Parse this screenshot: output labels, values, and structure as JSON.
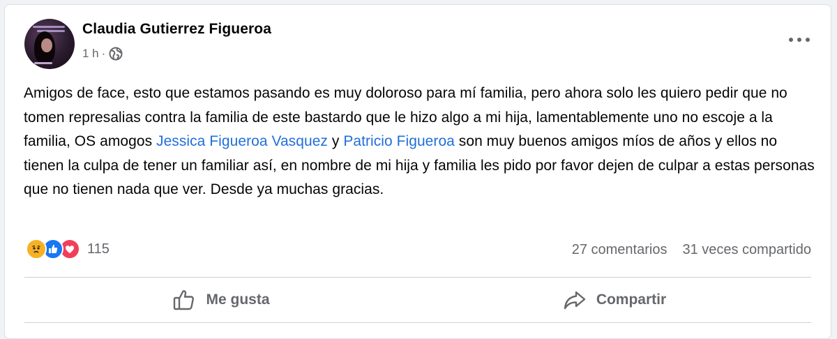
{
  "post": {
    "author": "Claudia Gutierrez Figueroa",
    "time": "1 h",
    "dot": "·",
    "text_parts": {
      "p1": "Amigos de face, esto que estamos pasando es muy doloroso para mí familia, pero ahora solo les quiero pedir que no tomen represalias contra la familia de este bastardo que le hizo algo a mi hija, lamentablemente uno no escoje a la familia, OS amogos ",
      "link1": "Jessica Figueroa Vasquez",
      "p2": " y ",
      "link2": "Patricio Figueroa",
      "p3": "  son muy buenos amigos míos de años y ellos no tienen la culpa de tener un familiar así, en nombre de mi hija y familia les pido por favor dejen de culpar a estas personas que no tienen nada que ver. Desde ya muchas gracias."
    },
    "link_color": "#216fdb"
  },
  "stats": {
    "reactions_count": "115",
    "reaction_icons": [
      "sad-icon",
      "like-icon",
      "love-icon"
    ],
    "comments": "27 comentarios",
    "shares": "31 veces compartido"
  },
  "actions": {
    "like_label": "Me gusta",
    "share_label": "Compartir"
  }
}
